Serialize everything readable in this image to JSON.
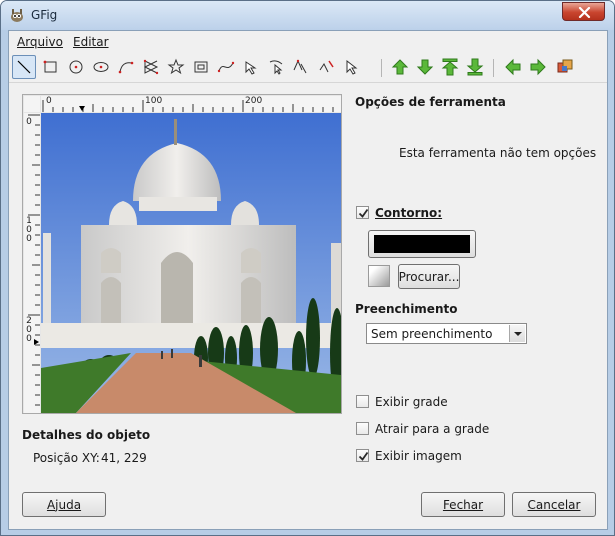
{
  "window": {
    "title": "GFig"
  },
  "menu": {
    "file": "Arquivo",
    "edit": "Editar"
  },
  "toolbar": {
    "tools": [
      "line-tool",
      "rectangle-tool",
      "circle-tool",
      "ellipse-tool",
      "arc-tool",
      "polygon-tool",
      "star-tool",
      "spiral-tool",
      "bezier-tool",
      "move-object-tool",
      "move-point-tool",
      "copy-object-tool",
      "delete-object-tool",
      "select-object-tool"
    ],
    "actions": [
      "raise-object",
      "lower-object",
      "raise-to-top",
      "lower-to-bottom",
      "show-previous",
      "show-next",
      "show-all"
    ]
  },
  "ruler": {
    "h": [
      "0",
      "100",
      "200"
    ],
    "v": [
      "0",
      "100",
      "200"
    ]
  },
  "tool_options": {
    "title": "Opções de ferramenta",
    "message": "Esta ferramenta não tem opções"
  },
  "stroke": {
    "label": "Contorno:",
    "checked": true,
    "color": "#000000",
    "browse": "Procurar..."
  },
  "fill": {
    "title": "Preenchimento",
    "selected": "Sem preenchimento"
  },
  "options": {
    "show_grid": {
      "label": "Exibir grade",
      "checked": false
    },
    "snap_grid": {
      "label": "Atrair para a grade",
      "checked": false
    },
    "show_image": {
      "label": "Exibir imagem",
      "checked": true
    }
  },
  "object_details": {
    "title": "Detalhes do objeto",
    "position_label": "Posição XY:",
    "position_value": "41, 229"
  },
  "buttons": {
    "help": "Ajuda",
    "close": "Fechar",
    "cancel": "Cancelar"
  }
}
